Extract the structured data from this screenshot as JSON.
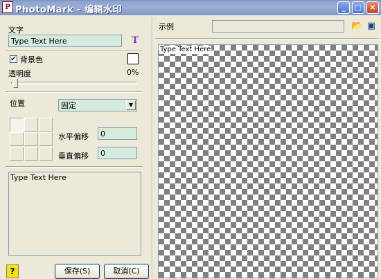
{
  "window": {
    "icon_label": "P",
    "title": "PhotoMark - 编辑水印"
  },
  "titlebar_buttons": {
    "minimize": "_",
    "maximize": "□",
    "close": "×"
  },
  "text_section": {
    "label": "文字",
    "value": "Type Text Here",
    "font_icon": "T"
  },
  "background": {
    "label": "背景色",
    "checked": "✔"
  },
  "opacity": {
    "label": "透明度",
    "value_text": "0%",
    "value": 0
  },
  "position": {
    "label": "位置",
    "selected": "固定",
    "dropdown_arrow": "▼",
    "h_offset_label": "水平偏移",
    "h_offset_value": "0",
    "v_offset_label": "垂直偏移",
    "v_offset_value": "0"
  },
  "text_area": {
    "value": "Type Text Here"
  },
  "buttons": {
    "help": "?",
    "save": "保存(S)",
    "cancel": "取消(C)"
  },
  "preview": {
    "label": "示例",
    "overlay_text": "Type Text Here",
    "open_icon": "📂",
    "window_icon": "▣"
  },
  "colors": {
    "field_bg": "#d6ebdb",
    "checker_dark": "#808080",
    "title_bar": "#8fa3cc"
  }
}
